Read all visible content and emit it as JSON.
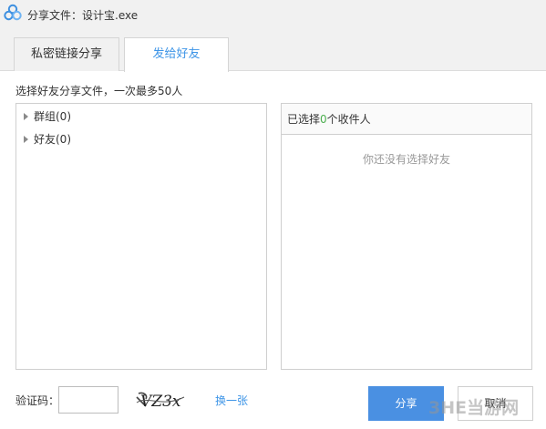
{
  "window": {
    "title": "分享文件：设计宝.exe",
    "icon": "baidu-cloud-logo-icon"
  },
  "tabs": [
    {
      "label": "私密链接分享",
      "active": false
    },
    {
      "label": "发给好友",
      "active": true
    }
  ],
  "instruction": "选择好友分享文件，一次最多50人",
  "tree": {
    "items": [
      {
        "label": "群组(0)",
        "icon": "expand-arrow-icon"
      },
      {
        "label": "好友(0)",
        "icon": "expand-arrow-icon"
      }
    ]
  },
  "selection": {
    "prefix": "已选择",
    "count": "0",
    "suffix": "个收件人",
    "empty_text": "你还没有选择好友"
  },
  "captcha": {
    "label": "验证码：",
    "value": "",
    "image_text": "VZ3x",
    "refresh_label": "换一张"
  },
  "buttons": {
    "share": "分享",
    "cancel": "取消"
  },
  "watermark": {
    "text": "3HE当游网"
  },
  "colors": {
    "accent": "#3e95e7",
    "primary_button": "#4a90e2",
    "count": "#4caf50",
    "title_bg": "#f1f1f1"
  }
}
